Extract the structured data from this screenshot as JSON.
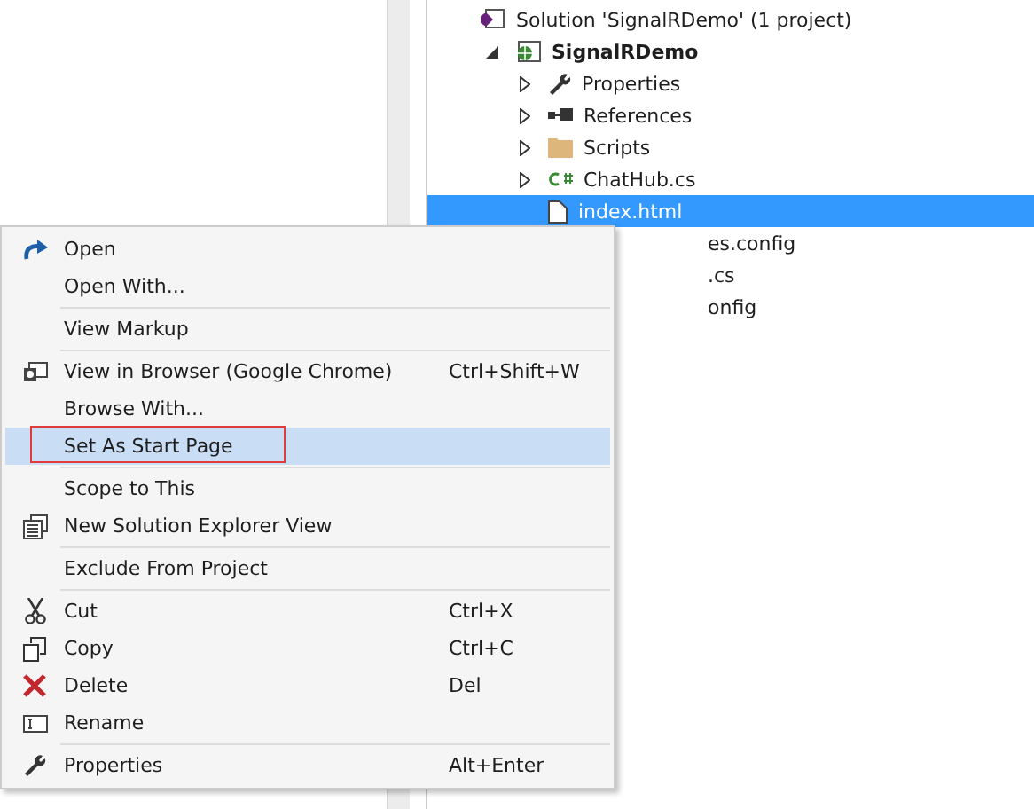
{
  "solution_explorer": {
    "tree": [
      {
        "label": "Solution 'SignalRDemo' (1 project)",
        "kind": "solution",
        "children": [
          {
            "label": "SignalRDemo",
            "kind": "project",
            "expanded": true,
            "children": [
              {
                "label": "Properties",
                "kind": "wrench",
                "expanded": false,
                "selected": false
              },
              {
                "label": "References",
                "kind": "references",
                "expanded": false,
                "selected": false
              },
              {
                "label": "Scripts",
                "kind": "folder",
                "expanded": false,
                "selected": false
              },
              {
                "label": "ChatHub.cs",
                "kind": "csharp",
                "expanded": false,
                "selected": false
              },
              {
                "label": "index.html",
                "kind": "file",
                "selected": true
              },
              {
                "label": "es.config",
                "kind": "covered",
                "selected": false
              },
              {
                "label": ".cs",
                "kind": "covered",
                "selected": false
              },
              {
                "label": "onfig",
                "kind": "covered",
                "selected": false
              }
            ]
          }
        ]
      }
    ]
  },
  "context_menu": {
    "groups": [
      [
        {
          "label": "Open",
          "kind": "open",
          "selected": false
        },
        {
          "label": "Open With...",
          "selected": false
        }
      ],
      [
        {
          "label": "View Markup",
          "selected": false
        }
      ],
      [
        {
          "label": "View in Browser (Google Chrome)",
          "kind": "browser",
          "shortcut": "Ctrl+Shift+W",
          "selected": false
        },
        {
          "label": "Browse With...",
          "selected": false
        },
        {
          "label": "Set As Start Page",
          "selected": true,
          "outlined": true
        }
      ],
      [
        {
          "label": "Scope to This",
          "selected": false
        },
        {
          "label": "New Solution Explorer View",
          "kind": "newview",
          "selected": false
        }
      ],
      [
        {
          "label": "Exclude From Project",
          "selected": false
        }
      ],
      [
        {
          "label": "Cut",
          "kind": "cut",
          "shortcut": "Ctrl+X",
          "selected": false
        },
        {
          "label": "Copy",
          "kind": "copy",
          "shortcut": "Ctrl+C",
          "selected": false
        },
        {
          "label": "Delete",
          "kind": "delete",
          "shortcut": "Del",
          "selected": false
        },
        {
          "label": "Rename",
          "kind": "rename",
          "selected": false
        }
      ],
      [
        {
          "label": "Properties",
          "kind": "wrench",
          "shortcut": "Alt+Enter",
          "selected": false
        }
      ]
    ]
  }
}
